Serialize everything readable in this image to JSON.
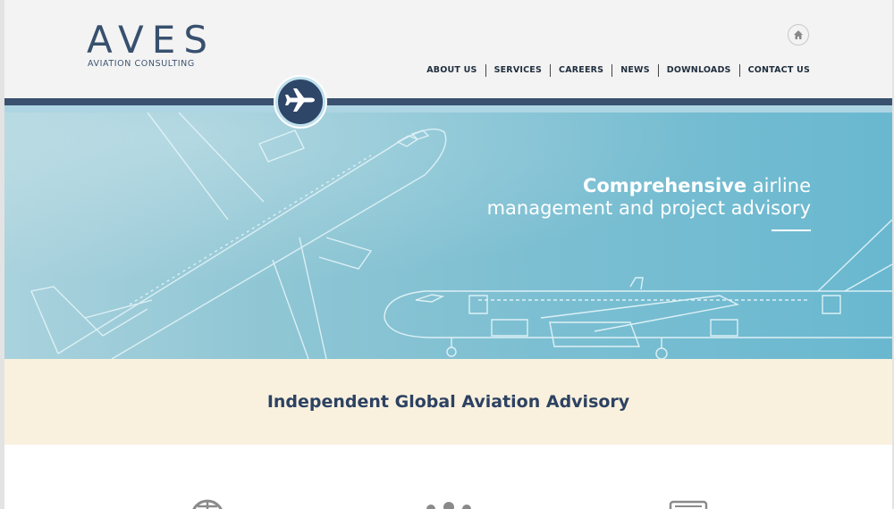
{
  "brand": {
    "name": "AVES",
    "tagline": "AVIATION CONSULTING"
  },
  "nav": {
    "home_icon": "home-icon",
    "items": [
      "ABOUT US",
      "SERVICES",
      "CAREERS",
      "NEWS",
      "DOWNLOADS",
      "CONTACT US"
    ]
  },
  "hero": {
    "badge_icon": "airplane-icon",
    "heading_bold": "Comprehensive",
    "heading_rest": " airline",
    "heading_line2": "management and project advisory"
  },
  "intro": {
    "title": "Independent Global Aviation Advisory"
  },
  "features": {
    "icons": [
      "globe-icon",
      "people-icon",
      "documents-icon"
    ]
  },
  "colors": {
    "navy": "#37506e",
    "stripe_dark": "#3a5170",
    "stripe_light": "#aed5e3",
    "hero_blue": "#69b8d0",
    "cream": "#f9f1de"
  }
}
